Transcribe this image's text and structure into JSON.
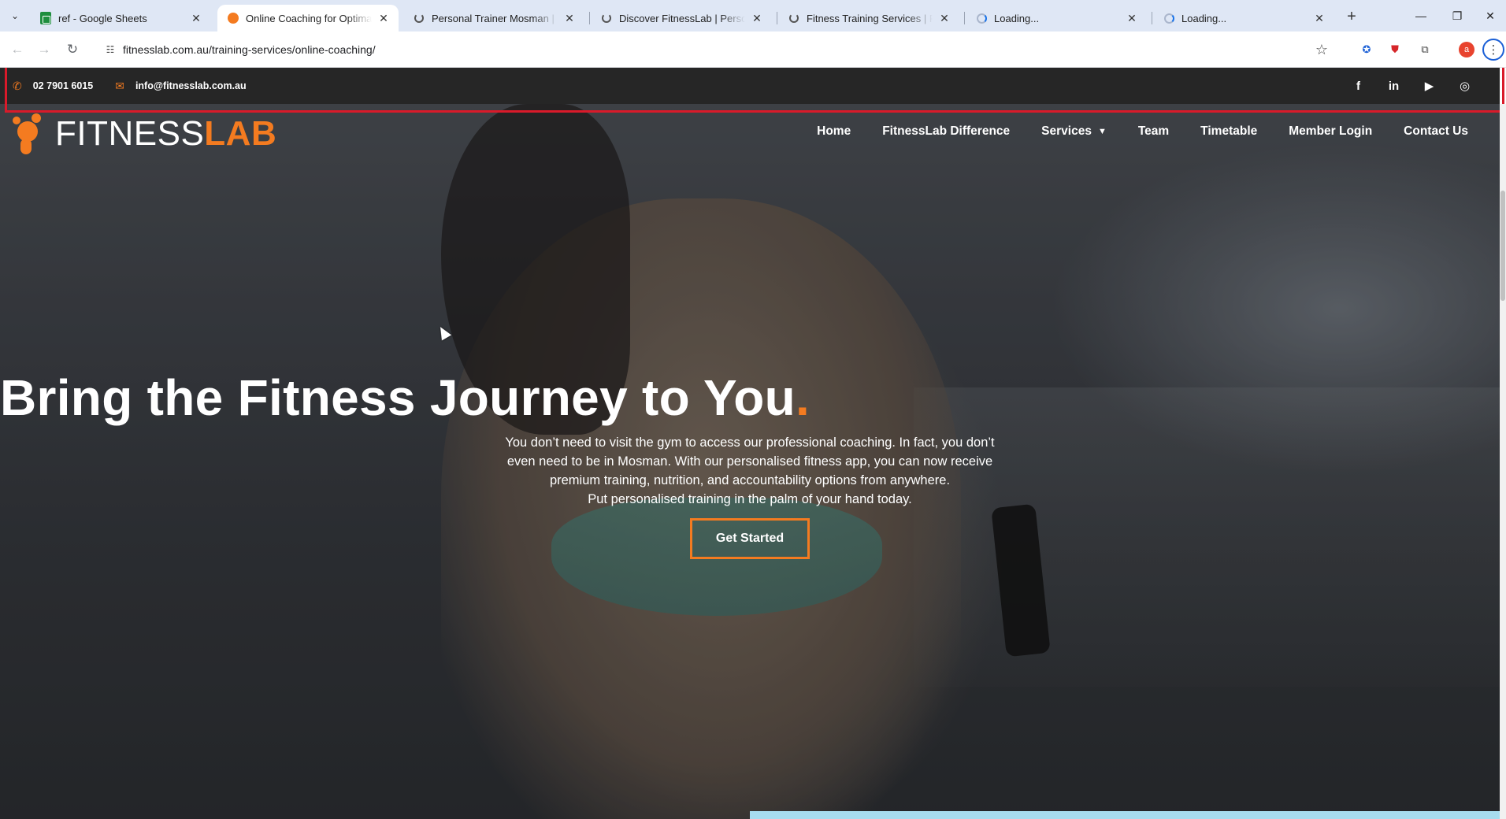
{
  "browser": {
    "tabs": [
      {
        "title": "ref - Google Sheets",
        "favicon": "sheets-icon",
        "active": false
      },
      {
        "title": "Online Coaching for Optimal Tr",
        "favicon": "fitnesslab-icon",
        "active": true
      },
      {
        "title": "Personal Trainer Mosman | Fitn",
        "favicon": "site-icon",
        "active": false
      },
      {
        "title": "Discover FitnessLab | Personal T",
        "favicon": "site-icon",
        "active": false
      },
      {
        "title": "Fitness Training Services | Perso",
        "favicon": "site-icon",
        "active": false
      },
      {
        "title": "Loading...",
        "favicon": "loading-icon",
        "active": false
      },
      {
        "title": "Loading...",
        "favicon": "loading-icon",
        "active": false
      }
    ],
    "url": "fitnesslab.com.au/training-services/online-coaching/",
    "profile_initial": "a"
  },
  "topbar": {
    "phone": "02 7901 6015",
    "email": "info@fitnesslab.com.au",
    "socials": [
      "facebook-icon",
      "linkedin-icon",
      "youtube-icon",
      "instagram-icon"
    ]
  },
  "logo": {
    "part1": "FITNESS",
    "part2": "LAB"
  },
  "nav": {
    "home": "Home",
    "difference": "FitnessLab Difference",
    "services": "Services",
    "team": "Team",
    "timetable": "Timetable",
    "member_login": "Member Login",
    "contact": "Contact Us"
  },
  "hero": {
    "headline": "Bring the Fitness Journey to You",
    "headline_dot": ".",
    "line1": "You don’t need to visit the gym to access our professional coaching. In fact, you don’t",
    "line2": "even need to be in Mosman. With our personalised fitness app, you can now receive",
    "line3": "premium training, nutrition, and accountability options from anywhere.",
    "line4": "Put personalised training in the palm of your hand today.",
    "cta": "Get Started"
  },
  "colors": {
    "accent": "#f47b20",
    "topbar_bg": "#262626",
    "highlight": "#d91a2a"
  }
}
